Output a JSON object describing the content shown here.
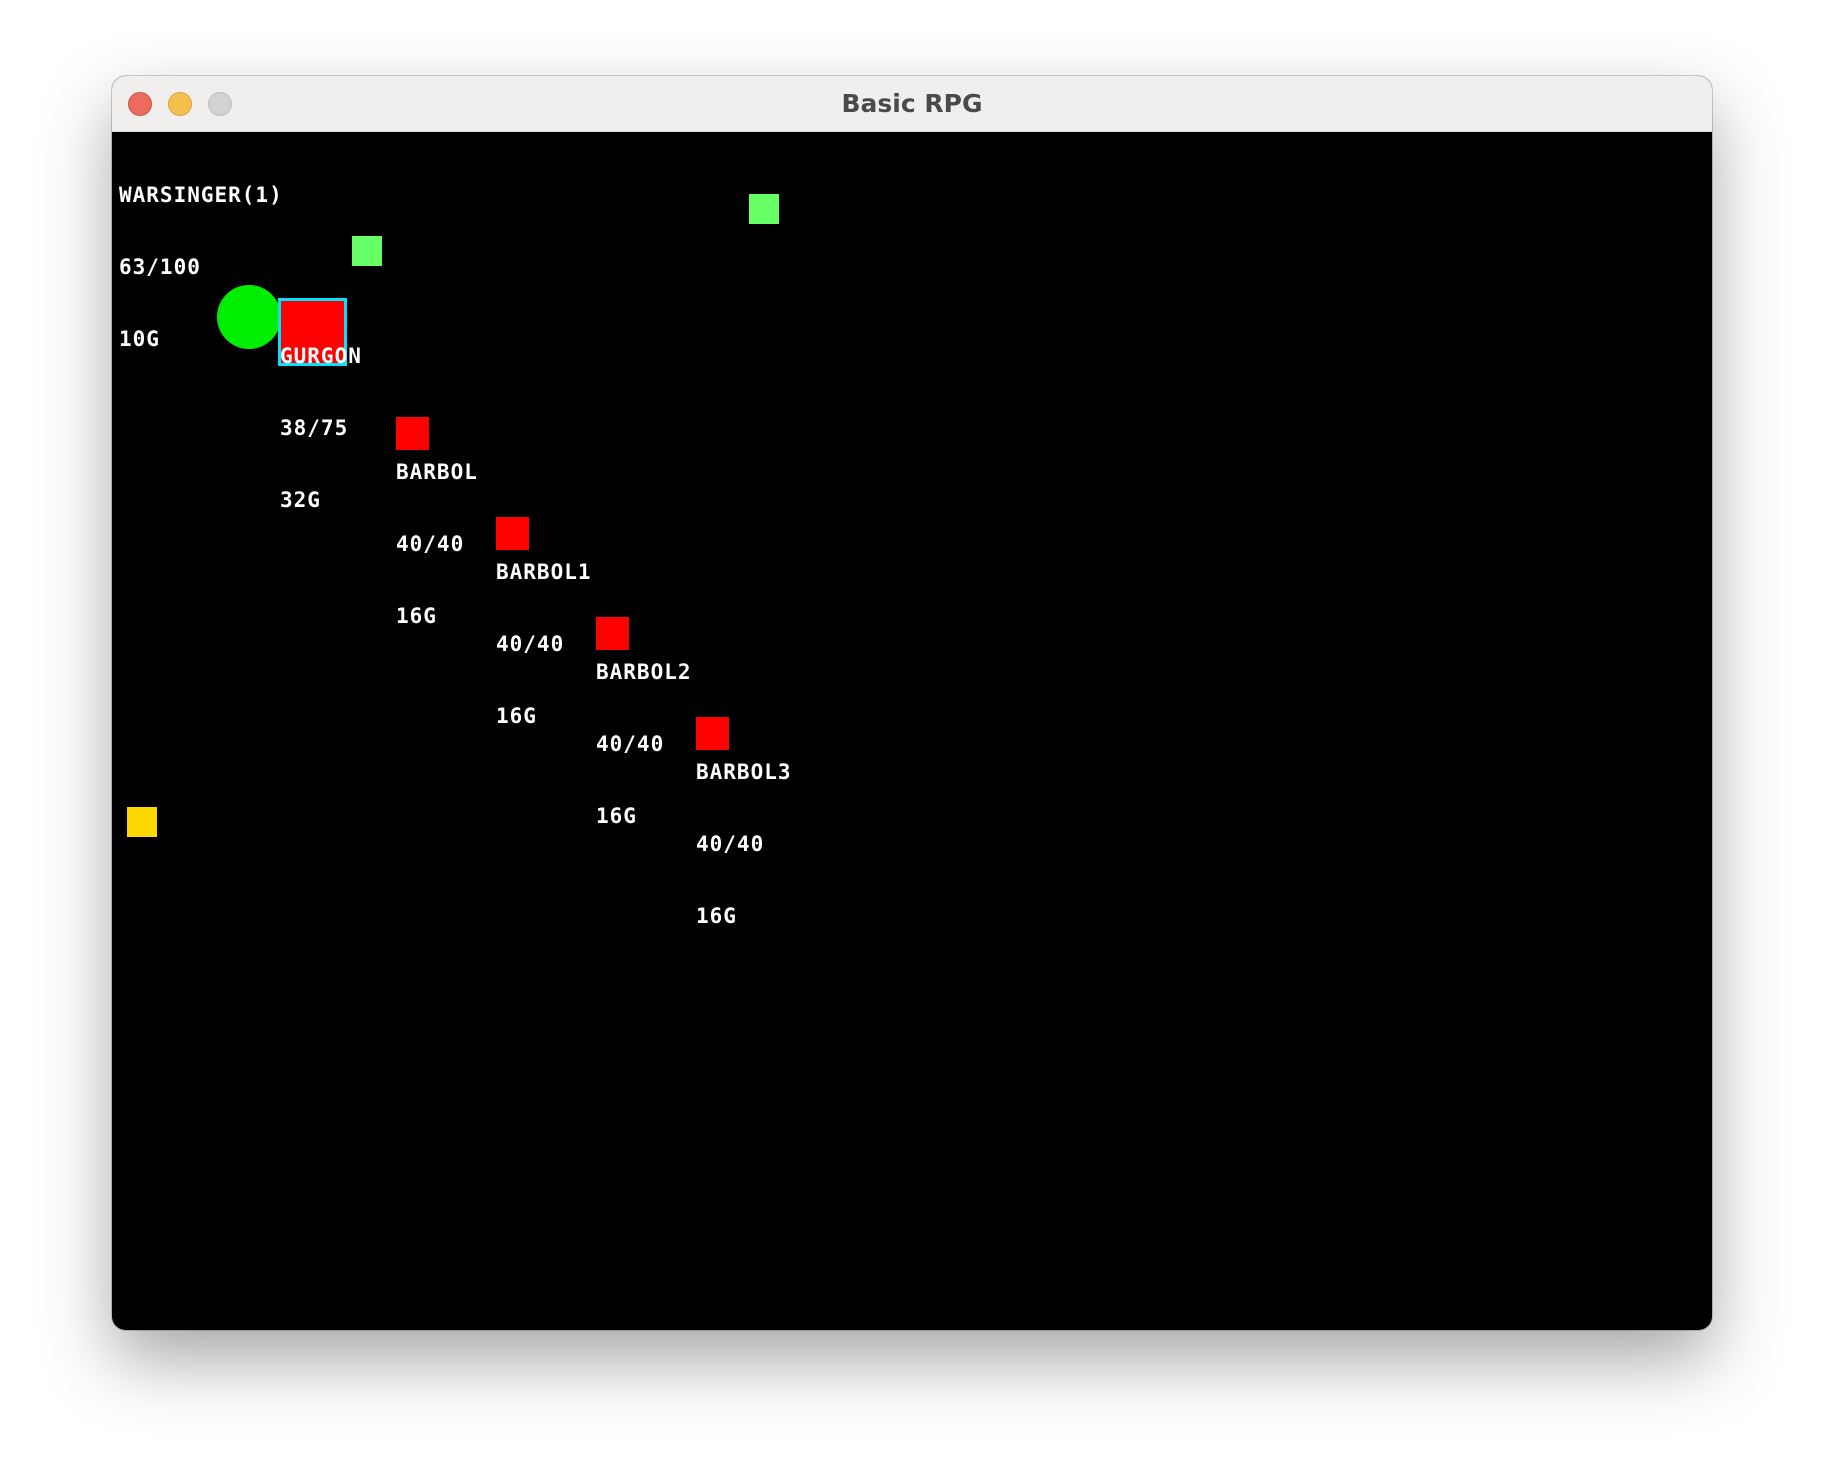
{
  "window": {
    "title": "Basic RPG"
  },
  "player": {
    "name": "WARSINGER(1)",
    "hp": "63/100",
    "gold": "10G",
    "color": "#00ee00"
  },
  "enemies": [
    {
      "name": "GURGON",
      "hp": "38/75",
      "gold": "32G",
      "selected": true,
      "color": "#ff0000",
      "selection_color": "#00e5ff"
    },
    {
      "name": "BARBOL",
      "hp": "40/40",
      "gold": "16G",
      "selected": false,
      "color": "#ff0000"
    },
    {
      "name": "BARBOL1",
      "hp": "40/40",
      "gold": "16G",
      "selected": false,
      "color": "#ff0000"
    },
    {
      "name": "BARBOL2",
      "hp": "40/40",
      "gold": "16G",
      "selected": false,
      "color": "#ff0000"
    },
    {
      "name": "BARBOL3",
      "hp": "40/40",
      "gold": "16G",
      "selected": false,
      "color": "#ff0000"
    }
  ],
  "items": [
    {
      "kind": "green-item",
      "color": "#66ff66"
    },
    {
      "kind": "green-item",
      "color": "#66ff66"
    },
    {
      "kind": "yellow-item",
      "color": "#ffd700"
    }
  ]
}
